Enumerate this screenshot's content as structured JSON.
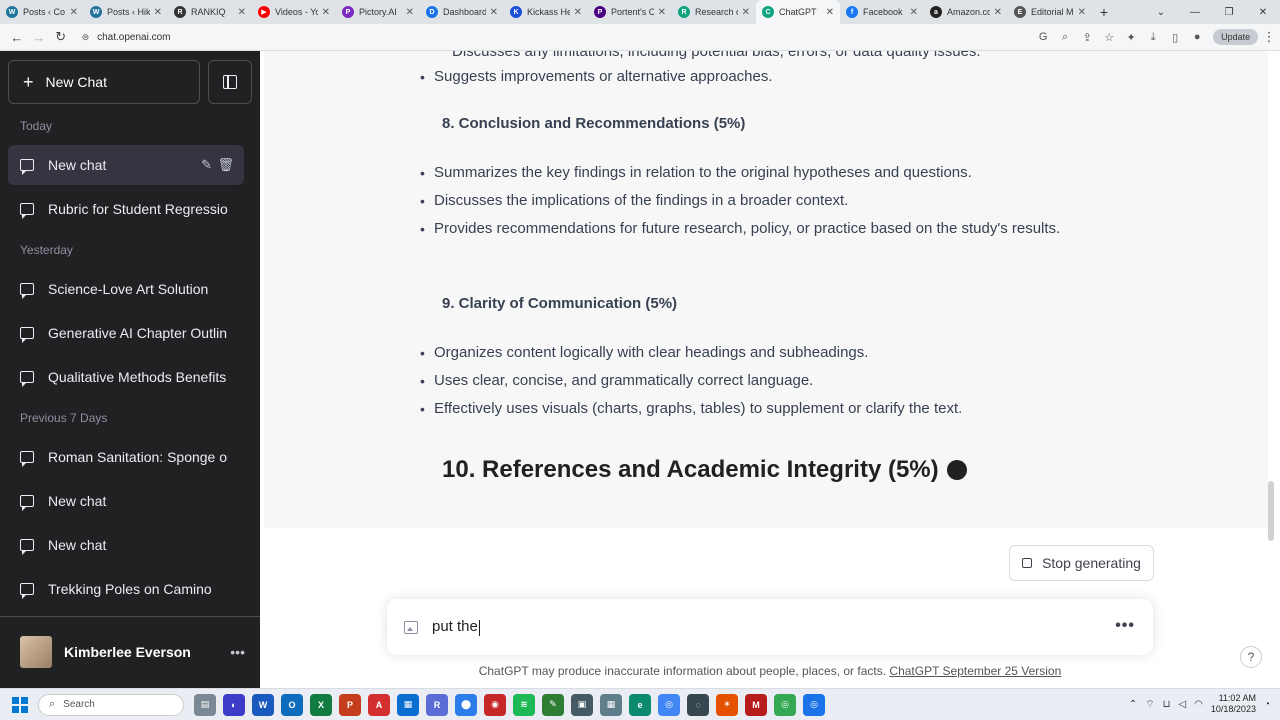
{
  "browser": {
    "tabs": [
      {
        "title": "Posts ‹ Co",
        "color": "#21759b",
        "glyph": "W"
      },
      {
        "title": "Posts ‹ Hik",
        "color": "#21759b",
        "glyph": "W"
      },
      {
        "title": "RANKIQ",
        "color": "#333333",
        "glyph": "R"
      },
      {
        "title": "Videos - Yo",
        "color": "#ff0000",
        "glyph": "▶"
      },
      {
        "title": "Pictory.AI",
        "color": "#7b2cbf",
        "glyph": "P"
      },
      {
        "title": "Dashboard",
        "color": "#1a73e8",
        "glyph": "D"
      },
      {
        "title": "Kickass He",
        "color": "#1d4ed8",
        "glyph": "K"
      },
      {
        "title": "Portent's C",
        "color": "#4b0082",
        "glyph": "P"
      },
      {
        "title": "Research o",
        "color": "#10a37f",
        "glyph": "R"
      },
      {
        "title": "ChatGPT",
        "color": "#10a37f",
        "glyph": "C",
        "active": true
      },
      {
        "title": "Facebook",
        "color": "#1877f2",
        "glyph": "f"
      },
      {
        "title": "Amazon.co",
        "color": "#222222",
        "glyph": "a"
      },
      {
        "title": "Editorial M",
        "color": "#555555",
        "glyph": "E"
      }
    ],
    "url": "chat.openai.com",
    "update_label": "Update"
  },
  "sidebar": {
    "new_chat_label": "New Chat",
    "sections": [
      {
        "label": "Today",
        "items": [
          "New chat",
          "Rubric for Student Regressio"
        ]
      },
      {
        "label": "Yesterday",
        "items": [
          "Science-Love Art Solution",
          "Generative AI Chapter Outlin",
          "Qualitative Methods Benefits"
        ]
      },
      {
        "label": "Previous 7 Days",
        "items": [
          "Roman Sanitation: Sponge or",
          "New chat",
          "New chat",
          "Trekking Poles on Camino"
        ]
      }
    ],
    "user_name": "Kimberlee Everson"
  },
  "conversation": {
    "cut_line": "Discusses any limitations, including potential bias, errors, or data quality issues.",
    "bullet_top": "Suggests improvements or alternative approaches.",
    "section8": {
      "heading": "8. Conclusion and Recommendations (5%)",
      "bullets": [
        "Summarizes the key findings in relation to the original hypotheses and questions.",
        "Discusses the implications of the findings in a broader context.",
        "Provides recommendations for future research, policy, or practice based on the study's results."
      ]
    },
    "section9": {
      "heading": "9. Clarity of Communication (5%)",
      "bullets": [
        "Organizes content logically with clear headings and subheadings.",
        "Uses clear, concise, and grammatically correct language.",
        "Effectively uses visuals (charts, graphs, tables) to supplement or clarify the text."
      ]
    },
    "section10_heading": "10. References and Academic Integrity (5%)"
  },
  "composer": {
    "stop_label": "Stop generating",
    "input_value": "put the"
  },
  "footer": {
    "disclaimer": "ChatGPT may produce inaccurate information about people, places, or facts.",
    "version_link": "ChatGPT September 25 Version",
    "help": "?"
  },
  "taskbar": {
    "search_placeholder": "Search",
    "time": "11:02 AM",
    "date": "10/18/2023"
  }
}
